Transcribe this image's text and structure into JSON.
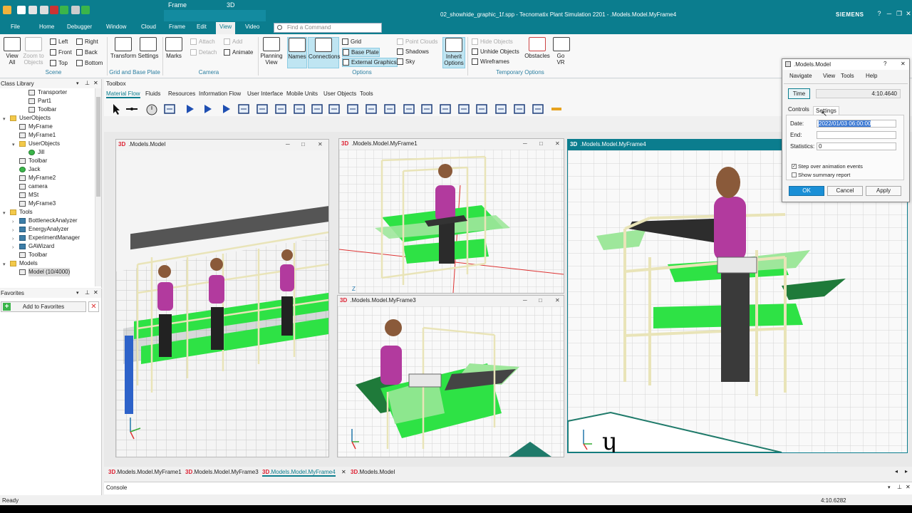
{
  "app": {
    "doc_title": "02_showhide_graphic_1f.spp - Tecnomatix Plant Simulation 2201 - .Models.Model.MyFrame4",
    "brand": "SIEMENS",
    "context_group_frame": "Frame",
    "context_group_3d": "3D"
  },
  "ribbon_tabs": [
    "File",
    "Home",
    "Debugger",
    "Window",
    "Cloud",
    "Frame",
    "Edit",
    "View",
    "Video"
  ],
  "active_tab": "View",
  "find_placeholder": "Find a Command",
  "ribbon": {
    "view_all": "View All",
    "zoom_objects": "Zoom to Objects",
    "left": "Left",
    "right": "Right",
    "front": "Front",
    "back": "Back",
    "top": "Top",
    "bottom": "Bottom",
    "scene_group": "Scene",
    "transform": "Transform",
    "settings": "Settings",
    "grid_group": "Grid and Base Plate",
    "marks": "Marks",
    "attach": "Attach",
    "detach": "Detach",
    "add": "Add",
    "animate": "Animate",
    "camera_group": "Camera",
    "planning_view": "Planning View",
    "names": "Names",
    "connections": "Connections",
    "grid": "Grid",
    "base_plate": "Base Plate",
    "external_graphics": "External Graphics",
    "point_clouds": "Point Clouds",
    "shadows": "Shadows",
    "sky": "Sky",
    "inherit_options": "Inherit Options",
    "options_group": "Options",
    "hide_objects": "Hide Objects",
    "unhide_objects": "Unhide Objects",
    "wireframes": "Wireframes",
    "obstacles": "Obstacles",
    "go_vr": "Go VR",
    "temp_group": "Temporary Options"
  },
  "class_library": {
    "title": "Class Library",
    "items": [
      {
        "label": "Transporter",
        "depth": 2,
        "icon": "transporter-icon"
      },
      {
        "label": "Part1",
        "depth": 2,
        "icon": "part-icon"
      },
      {
        "label": "Toolbar",
        "depth": 2,
        "icon": "toolbar-icon"
      },
      {
        "label": "UserObjects",
        "depth": 0,
        "icon": "folder-icon",
        "toggle": "▾"
      },
      {
        "label": "MyFrame",
        "depth": 1,
        "icon": "frame-icon"
      },
      {
        "label": "MyFrame1",
        "depth": 1,
        "icon": "frame-icon"
      },
      {
        "label": "UserObjects",
        "depth": 1,
        "icon": "folder-icon",
        "toggle": "▾"
      },
      {
        "label": "Jill",
        "depth": 2,
        "icon": "worker-icon"
      },
      {
        "label": "Toolbar",
        "depth": 1,
        "icon": "toolbar-icon"
      },
      {
        "label": "Jack",
        "depth": 1,
        "icon": "worker-icon"
      },
      {
        "label": "MyFrame2",
        "depth": 1,
        "icon": "frame-icon"
      },
      {
        "label": "camera",
        "depth": 1,
        "icon": "camera-icon"
      },
      {
        "label": "MSt",
        "depth": 1,
        "icon": "frame-icon"
      },
      {
        "label": "MyFrame3",
        "depth": 1,
        "icon": "frame-icon"
      },
      {
        "label": "Tools",
        "depth": 0,
        "icon": "folder-icon",
        "toggle": "▾"
      },
      {
        "label": "BottleneckAnalyzer",
        "depth": 1,
        "icon": "tool-icon",
        "toggle": "›"
      },
      {
        "label": "EnergyAnalyzer",
        "depth": 1,
        "icon": "tool-icon",
        "toggle": "›"
      },
      {
        "label": "ExperimentManager",
        "depth": 1,
        "icon": "tool-icon",
        "toggle": "›"
      },
      {
        "label": "GAWizard",
        "depth": 1,
        "icon": "tool-icon",
        "toggle": "›"
      },
      {
        "label": "Toolbar",
        "depth": 1,
        "icon": "toolbar-icon"
      },
      {
        "label": "Models",
        "depth": 0,
        "icon": "folder-icon",
        "toggle": "▾"
      },
      {
        "label": "Model (10/4000)",
        "depth": 1,
        "icon": "frame-icon",
        "selected": true
      }
    ]
  },
  "favorites": {
    "title": "Favorites",
    "add_button": "Add to Favorites"
  },
  "toolbox": {
    "title": "Toolbox",
    "tabs": [
      "Material Flow",
      "Fluids",
      "Resources",
      "Information Flow",
      "User Interface",
      "Mobile Units",
      "User Objects",
      "Tools"
    ],
    "active": "Material Flow"
  },
  "windows": {
    "model": ".Models.Model",
    "frame1": ".Models.Model.MyFrame1",
    "frame3": ".Models.Model.MyFrame3",
    "frame4": ".Models.Model.MyFrame4",
    "tag_3d": "3D"
  },
  "dialog": {
    "title": ".Models.Model",
    "menu": [
      "Navigate",
      "View",
      "Tools",
      "Help"
    ],
    "time_label": "Time",
    "time_value": "4:10.4640",
    "tabs": [
      "Controls",
      "Settings"
    ],
    "date_label": "Date:",
    "date_value": "2022/01/03 06:00:00",
    "end_label": "End:",
    "end_value": "",
    "stats_label": "Statistics:",
    "stats_value": "0",
    "step_over": "Step over animation events",
    "step_over_checked": true,
    "summary": "Show summary report",
    "summary_checked": false,
    "ok": "OK",
    "cancel": "Cancel",
    "apply": "Apply"
  },
  "doc_tabs": [
    {
      "tag": "3D",
      "label": ".Models.Model.MyFrame1"
    },
    {
      "tag": "3D",
      "label": ".Models.Model.MyFrame3"
    },
    {
      "tag": "3D",
      "label": ".Models.Model.MyFrame4",
      "active": true
    },
    {
      "tag": "3D",
      "label": ".Models.Model"
    }
  ],
  "console_label": "Console",
  "status": {
    "left": "Ready",
    "right": "4:10.6282"
  },
  "colors": {
    "accent": "#0b7d8e",
    "green_plate": "#34e34a",
    "figure_shirt": "#b23a9e"
  }
}
